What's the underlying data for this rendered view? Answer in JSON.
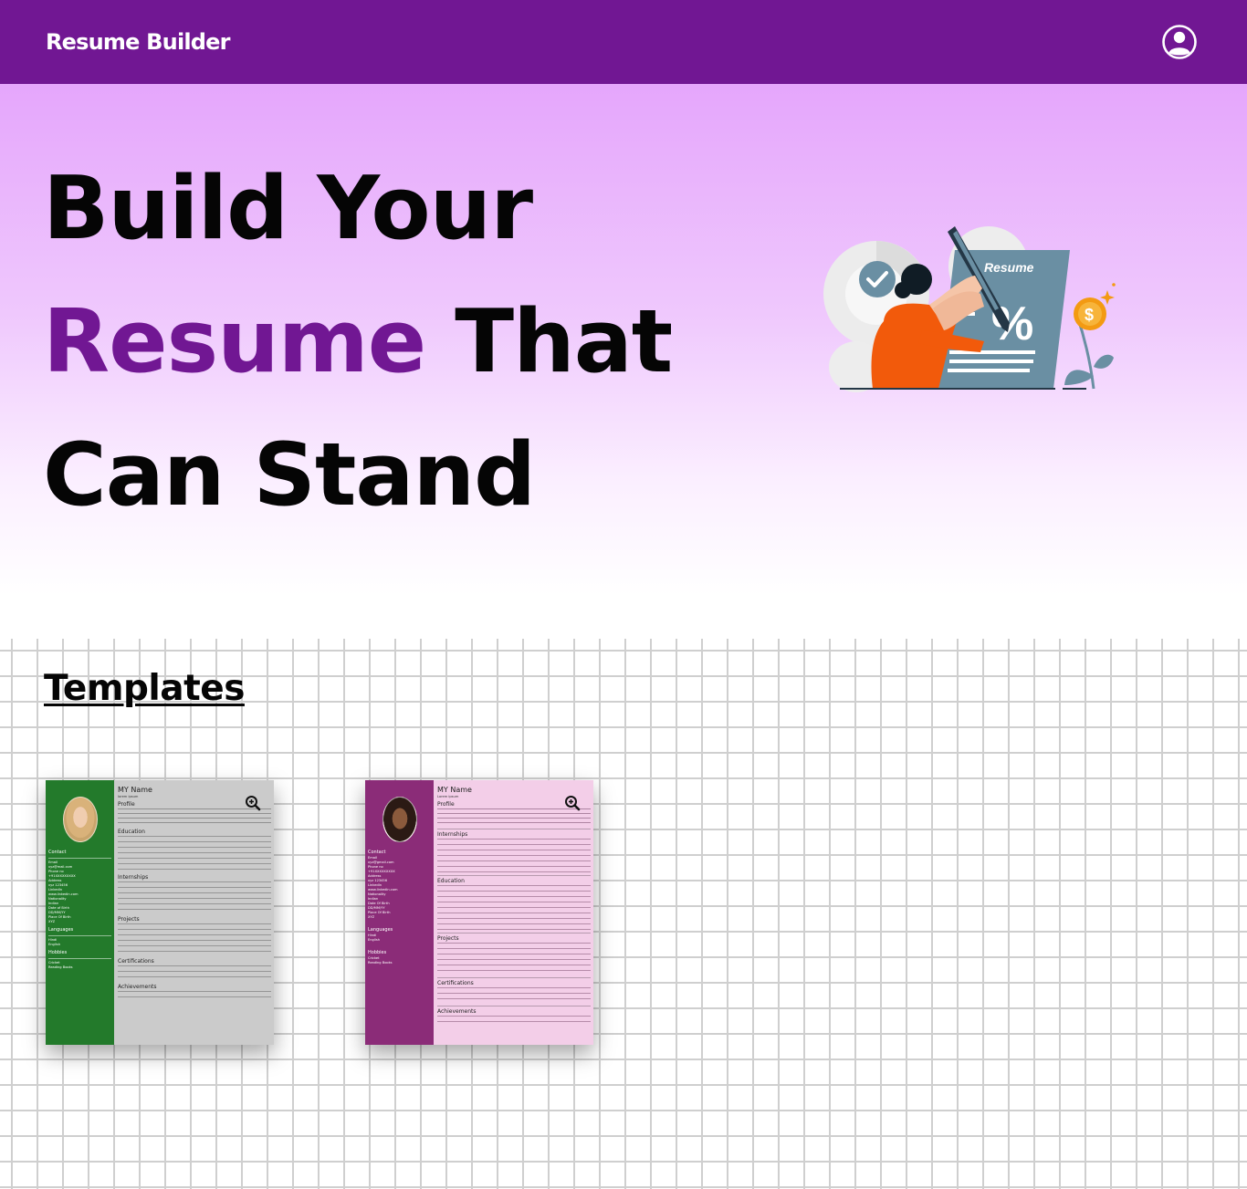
{
  "navbar": {
    "brand": "Resume Builder",
    "user_icon": "user-circle-icon"
  },
  "hero": {
    "line1": "Build Your",
    "line2_accent": "Resume",
    "line2_rest": " That",
    "line3": "Can Stand",
    "illustration_label": "Resume",
    "illustration_percent": "%",
    "illustration_currency": "$"
  },
  "templates": {
    "title": "Templates",
    "cards": [
      {
        "name": "MY Name",
        "subtitle": "lorem ipsum",
        "side": [
          "Contact",
          "Email",
          "xyz@mail.com",
          "Phone no",
          "+91XXXXXXXXX",
          "Address",
          "xyz 123456",
          "LinkedIn",
          "www.linkedin.com",
          "Nationality",
          "Indian",
          "Date of Birth",
          "DD/MM/YY",
          "Place Of Birth",
          "XYZ"
        ],
        "side_sections": [
          "Languages",
          "Hindi",
          "English",
          "Hobbies",
          "Cricket",
          "Reading Books"
        ],
        "main_sections": [
          "Profile",
          "Education",
          "Internships",
          "Projects",
          "Certifications",
          "Achievements"
        ]
      },
      {
        "name": "MY Name",
        "subtitle": "Lorem ipsum",
        "side": [
          "Contact",
          "Email",
          "xyz@gmail.com",
          "Phone no",
          "+91XXXXXXXXX",
          "Address",
          "xyz 123456",
          "LinkedIn",
          "www.linkedin.com",
          "Nationality",
          "Indian",
          "Date Of Birth",
          "DD/MM/YY",
          "Place Of Birth",
          "XYZ"
        ],
        "side_sections": [
          "Languages",
          "Hindi",
          "English",
          "Hobbies",
          "Cricket",
          "Reading Books"
        ],
        "main_sections": [
          "Profile",
          "Internships",
          "Education",
          "Projects",
          "Certifications",
          "Achievements"
        ]
      }
    ],
    "zoom_icon": "zoom-in-icon"
  },
  "colors": {
    "primary": "#711793",
    "hero_top": "#e5a6fc",
    "card1_side": "#237a2b",
    "card1_main": "#cbcbcb",
    "card2_side": "#8b2c78",
    "card2_main": "#f3cee8"
  }
}
